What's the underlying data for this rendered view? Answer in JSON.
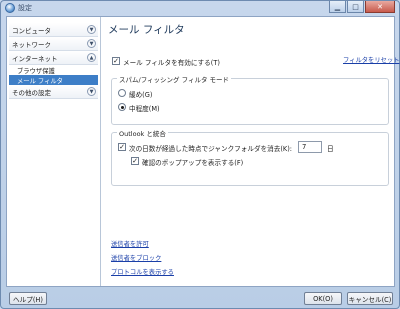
{
  "window": {
    "title": "設定"
  },
  "sidebar": {
    "sections": [
      {
        "label": "コンピュータ"
      },
      {
        "label": "ネットワーク"
      },
      {
        "label": "インターネット"
      }
    ],
    "subitems": [
      {
        "label": "ブラウザ保護",
        "selected": false
      },
      {
        "label": "メール フィルタ",
        "selected": true
      }
    ],
    "last_section": {
      "label": "その他の設定"
    }
  },
  "main": {
    "heading": "メール フィルタ",
    "enable_label": "メール フィルタを有効にする(T)",
    "enable_checked": true,
    "reset_link": "フィルタをリセット",
    "mode_group": {
      "title": "スパム/フィッシング フィルタ モード",
      "options": [
        {
          "label": "緩め(G)",
          "selected": false
        },
        {
          "label": "中程度(M)",
          "selected": true
        }
      ]
    },
    "outlook_group": {
      "title": "Outlook と統合",
      "delete_label": "次の日数が経過した時点でジャンクフォルダを消去(K):",
      "delete_checked": true,
      "days_value": "7",
      "days_unit": "日",
      "popup_label": "確認のポップアップを表示する(F)",
      "popup_checked": true
    },
    "links": [
      "送信者を許可",
      "送信者をブロック",
      "プロトコルを表示する"
    ]
  },
  "footer": {
    "help": "ヘルプ(H)",
    "ok": "OK(O)",
    "cancel": "キャンセル(C)"
  }
}
